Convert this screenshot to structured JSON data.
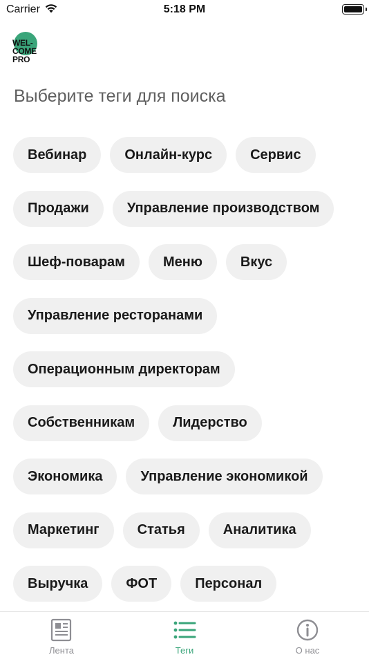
{
  "status_bar": {
    "carrier": "Carrier",
    "time": "5:18 PM"
  },
  "logo": {
    "lines": [
      "WEL-",
      "COME",
      "PRO"
    ]
  },
  "heading": "Выберите теги для поиска",
  "tag_rows": [
    [
      "Вебинар",
      "Онлайн-курс",
      "Сервис"
    ],
    [
      "Продажи",
      "Управление производством"
    ],
    [
      "Шеф-поварам",
      "Меню",
      "Вкус"
    ],
    [
      "Управление ресторанами"
    ],
    [
      "Операционным директорам"
    ],
    [
      "Собственникам",
      "Лидерство"
    ],
    [
      "Экономика",
      "Управление экономикой"
    ],
    [
      "Маркетинг",
      "Статья",
      "Аналитика"
    ],
    [
      "Выручка",
      "ФОТ",
      "Персонал"
    ]
  ],
  "tab_bar": {
    "tabs": [
      {
        "label": "Лента",
        "icon": "newspaper-icon",
        "active": false
      },
      {
        "label": "Теги",
        "icon": "list-icon",
        "active": true
      },
      {
        "label": "О нас",
        "icon": "info-icon",
        "active": false
      }
    ]
  },
  "colors": {
    "accent": "#3aa57a",
    "tag_background": "#f0f0f0",
    "inactive_tab": "#8e8e93"
  }
}
